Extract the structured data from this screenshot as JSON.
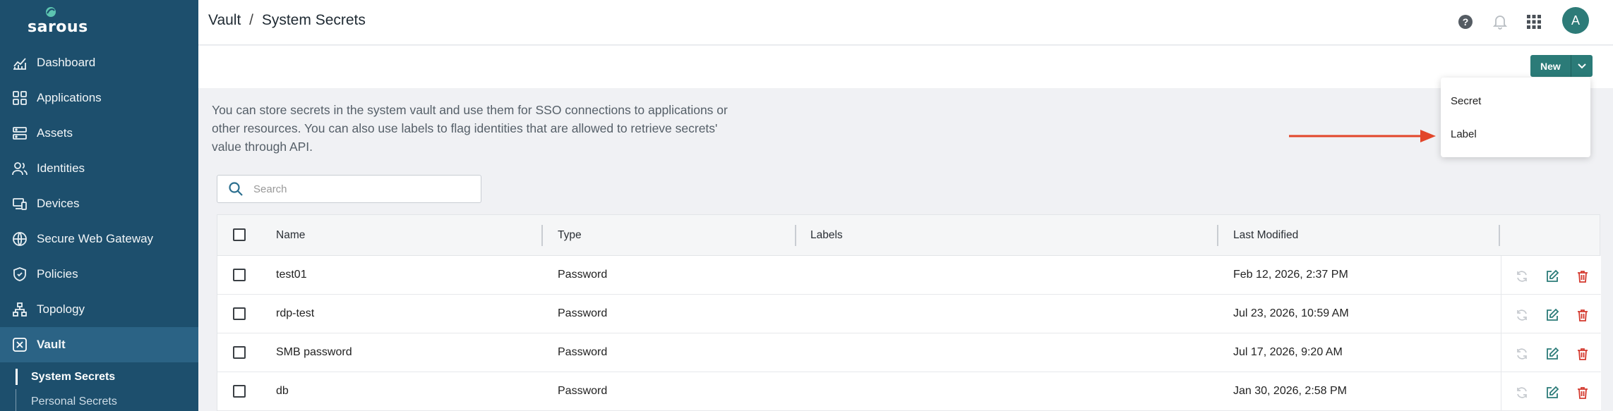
{
  "brand": {
    "name": "sarous"
  },
  "sidebar": {
    "items": [
      {
        "label": "Dashboard",
        "icon": "chart-icon"
      },
      {
        "label": "Applications",
        "icon": "grid-icon"
      },
      {
        "label": "Assets",
        "icon": "server-icon"
      },
      {
        "label": "Identities",
        "icon": "users-icon"
      },
      {
        "label": "Devices",
        "icon": "devices-icon"
      },
      {
        "label": "Secure Web Gateway",
        "icon": "globe-icon"
      },
      {
        "label": "Policies",
        "icon": "shield-icon"
      },
      {
        "label": "Topology",
        "icon": "topology-icon"
      },
      {
        "label": "Vault",
        "icon": "vault-icon",
        "active": true
      }
    ],
    "sub_items": [
      {
        "label": "System Secrets",
        "active": true
      },
      {
        "label": "Personal Secrets"
      }
    ]
  },
  "header": {
    "breadcrumb_root": "Vault",
    "breadcrumb_sep": "/",
    "breadcrumb_current": "System Secrets",
    "avatar_initial": "A"
  },
  "toolbar": {
    "new_label": "New"
  },
  "dropdown": {
    "items": [
      "Secret",
      "Label"
    ]
  },
  "description": "You can store secrets in the system vault and use them for SSO connections to applications or other resources. You can also use labels to flag identities that are allowed to retrieve secrets' value through API.",
  "search": {
    "placeholder": "Search"
  },
  "table": {
    "columns": {
      "name": "Name",
      "type": "Type",
      "labels": "Labels",
      "modified": "Last Modified"
    },
    "rows": [
      {
        "name": "test01",
        "type": "Password",
        "labels": "",
        "modified": "Feb 12, 2026, 2:37 PM"
      },
      {
        "name": "rdp-test",
        "type": "Password",
        "labels": "",
        "modified": "Jul 23, 2026, 10:59 AM"
      },
      {
        "name": "SMB password",
        "type": "Password",
        "labels": "",
        "modified": "Jul 17, 2026, 9:20 AM"
      },
      {
        "name": "db",
        "type": "Password",
        "labels": "",
        "modified": "Jan 30, 2026, 2:58 PM"
      }
    ]
  },
  "colors": {
    "sidebar": "#1d4f6d",
    "accent": "#2b7b78",
    "delete": "#d43a2f",
    "arrow": "#e2462a"
  }
}
